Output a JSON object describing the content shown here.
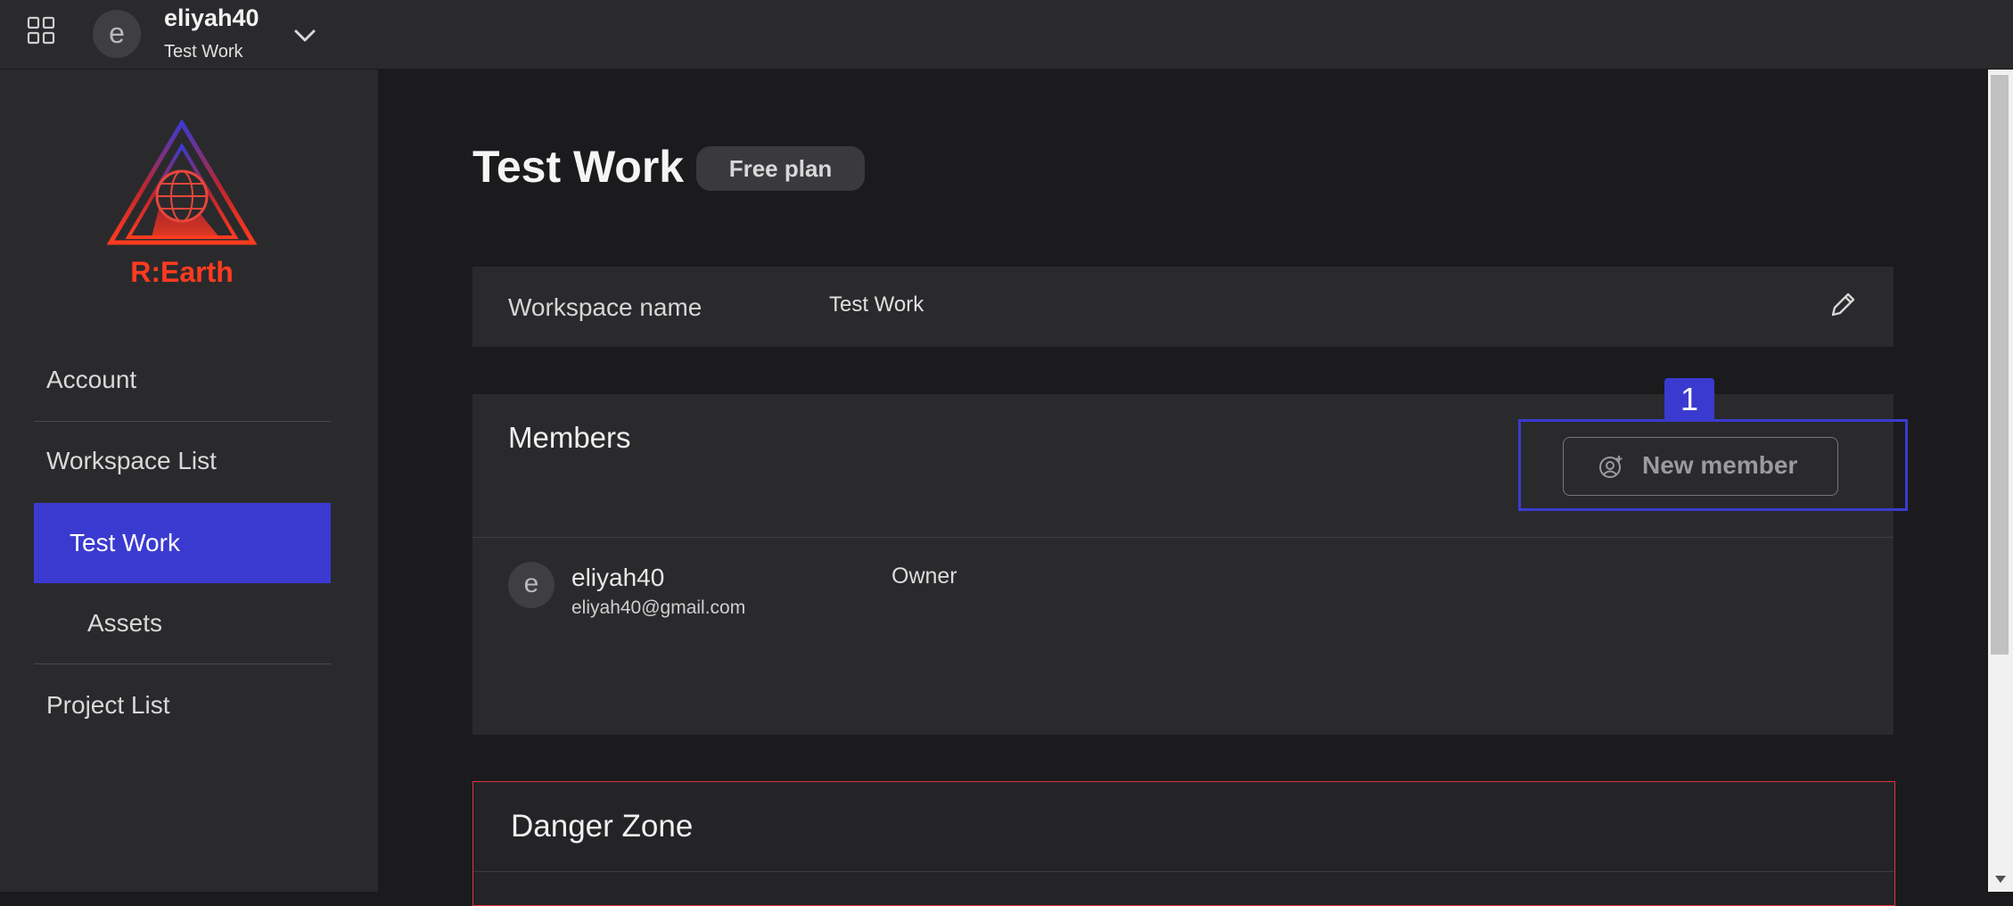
{
  "header": {
    "avatar_letter": "e",
    "username": "eliyah40",
    "workspace": "Test Work"
  },
  "sidebar": {
    "logo_text": "R:Earth",
    "items": [
      {
        "label": "Account"
      },
      {
        "label": "Workspace List"
      },
      {
        "label": "Test Work",
        "active": true
      },
      {
        "label": "Assets"
      },
      {
        "label": "Project List"
      }
    ]
  },
  "main": {
    "title": "Test Work",
    "plan_badge": "Free plan",
    "workspace_card": {
      "label": "Workspace name",
      "value": "Test Work"
    },
    "members": {
      "title": "Members",
      "new_member_label": "New member",
      "list": [
        {
          "avatar_letter": "e",
          "name": "eliyah40",
          "email": "eliyah40@gmail.com",
          "role": "Owner"
        }
      ]
    },
    "danger_zone": {
      "title": "Danger Zone"
    }
  },
  "annotation": {
    "tag": "1"
  },
  "colors": {
    "accent": "#3b3ad0",
    "danger_border": "#e0323d",
    "sidebar_bg": "#2a2a2d",
    "main_bg": "#1b1b1d"
  }
}
